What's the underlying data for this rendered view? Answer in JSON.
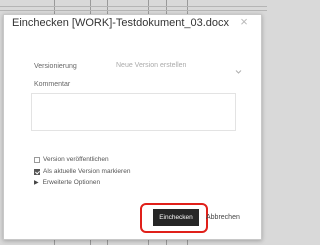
{
  "dialog": {
    "title": "Einchecken [WORK]-Testdokument_03.docx",
    "close_glyph": "×"
  },
  "form": {
    "versioning_label": "Versionierung",
    "versioning_value": "Neue Version erstellen",
    "comment_label": "Kommentar",
    "comment_value": "",
    "publish_label": "Version veröffentlichen",
    "publish_checked": false,
    "mark_current_label": "Als aktuelle Version markieren",
    "mark_current_checked": true,
    "advanced_label": "Erweiterte Optionen"
  },
  "buttons": {
    "checkin": "Einchecken",
    "cancel": "Abbrechen"
  },
  "icons": {
    "close": "close-icon",
    "dropdown": "chevron-down-icon",
    "expand": "triangle-right-icon"
  },
  "colors": {
    "primary_button": "#262626",
    "highlight": "#e0201a"
  }
}
